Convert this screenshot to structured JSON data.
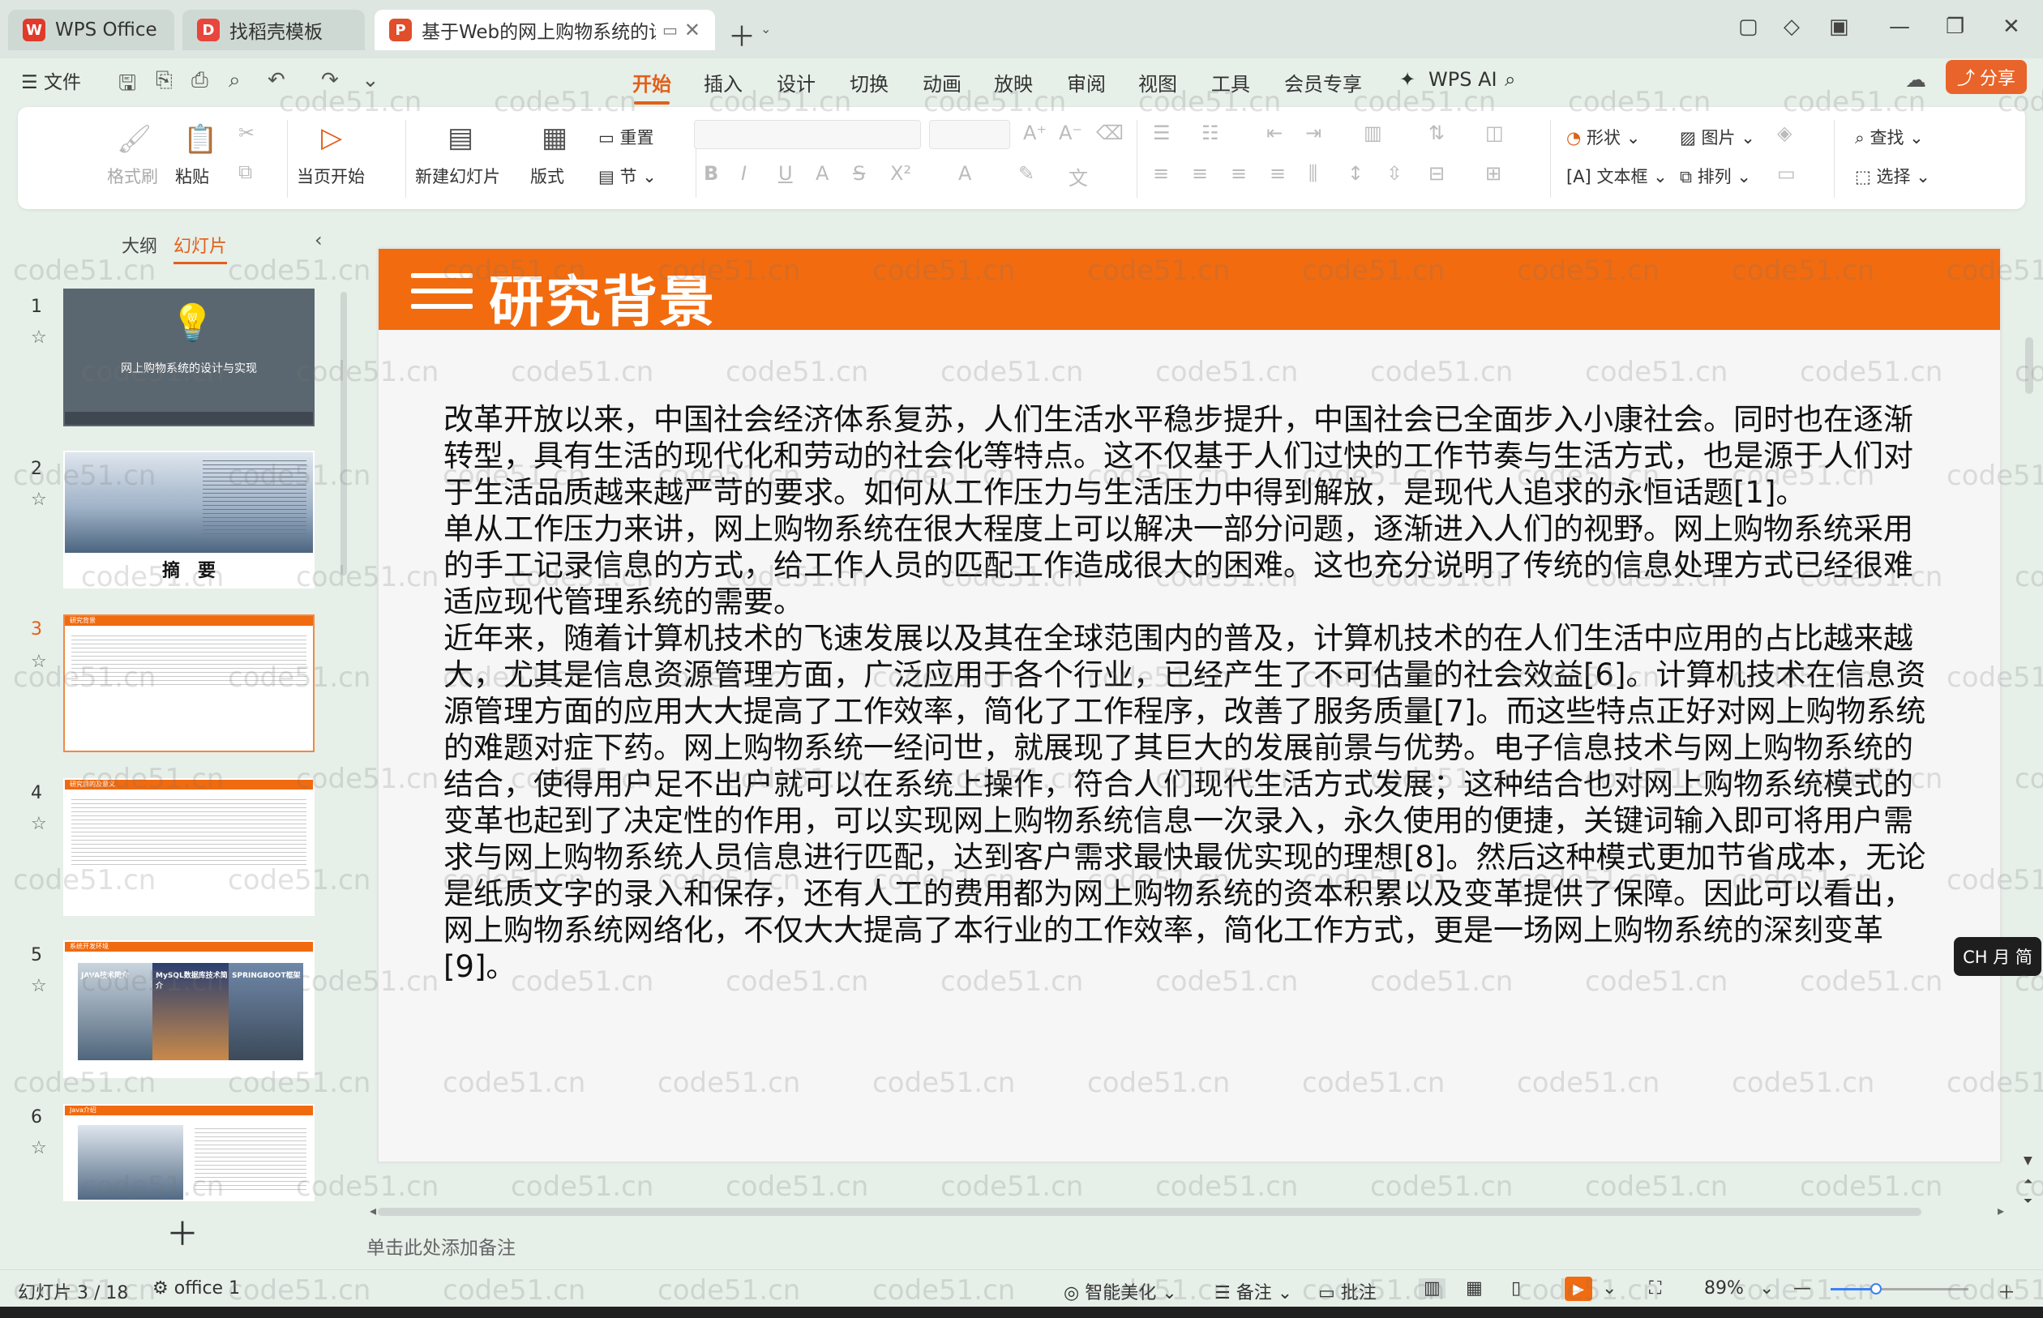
{
  "tabs": [
    {
      "label": "WPS Office"
    },
    {
      "label": "找稻壳模板"
    },
    {
      "label": "基于Web的网上购物系统的设"
    }
  ],
  "menu": {
    "file": "文件",
    "items": [
      "开始",
      "插入",
      "设计",
      "切换",
      "动画",
      "放映",
      "审阅",
      "视图",
      "工具",
      "会员专享",
      "WPS AI"
    ],
    "share": "分享"
  },
  "ribbon": {
    "format_painter": "格式刷",
    "paste": "粘贴",
    "from_current": "当页开始",
    "new_slide": "新建幻灯片",
    "layout": "版式",
    "reset": "重置",
    "section": "节",
    "shape": "形状",
    "picture": "图片",
    "find": "查找",
    "textbox": "文本框",
    "arrange": "排列",
    "select": "选择"
  },
  "panel": {
    "tab_outline": "大纲",
    "tab_slides": "幻灯片",
    "slides": [
      {
        "num": "1",
        "caption": "网上购物系统的设计与实现"
      },
      {
        "num": "2",
        "caption": "摘　要"
      },
      {
        "num": "3",
        "caption": "研究背景"
      },
      {
        "num": "4",
        "caption": "研究目的及意义"
      },
      {
        "num": "5",
        "caption": "系统开发环境",
        "tiles": [
          "JAVA技术简介",
          "MySQL数据库技术简介",
          "SPRINGBOOT框架"
        ]
      },
      {
        "num": "6",
        "caption": "Java介绍"
      }
    ]
  },
  "slide": {
    "title": "研究背景",
    "paragraphs": [
      "改革开放以来，中国社会经济体系复苏，人们生活水平稳步提升，中国社会已全面步入小康社会。同时也在逐渐转型，具有生活的现代化和劳动的社会化等特点。这不仅基于人们过快的工作节奏与生活方式，也是源于人们对于生活品质越来越严苛的要求。如何从工作压力与生活压力中得到解放，是现代人追求的永恒话题[1]。",
      "单从工作压力来讲，网上购物系统在很大程度上可以解决一部分问题，逐渐进入人们的视野。网上购物系统采用的手工记录信息的方式，给工作人员的匹配工作造成很大的困难。这也充分说明了传统的信息处理方式已经很难适应现代管理系统的需要。",
      "近年来，随着计算机技术的飞速发展以及其在全球范围内的普及，计算机技术的在人们生活中应用的占比越来越大，尤其是信息资源管理方面，广泛应用于各个行业，已经产生了不可估量的社会效益[6]。计算机技术在信息资源管理方面的应用大大提高了工作效率，简化了工作程序，改善了服务质量[7]。而这些特点正好对网上购物系统的难题对症下药。网上购物系统一经问世，就展现了其巨大的发展前景与优势。电子信息技术与网上购物系统的结合，使得用户足不出户就可以在系统上操作，符合人们现代生活方式发展；这种结合也对网上购物系统模式的变革也起到了决定性的作用，可以实现网上购物系统信息一次录入，永久使用的便捷，关键词输入即可将用户需求与网上购物系统人员信息进行匹配，达到客户需求最快最优实现的理想[8]。然后这种模式更加节省成本，无论是纸质文字的录入和保存，还有人工的费用都为网上购物系统的资本积累以及变革提供了保障。因此可以看出，网上购物系统网络化，不仅大大提高了本行业的工作效率，简化工作方式，更是一场网上购物系统的深刻变革[9]。"
    ]
  },
  "notes_placeholder": "单击此处添加备注",
  "ime": "CH ⽉ 简",
  "watermark": "code51.cn",
  "status": {
    "slide_info": "幻灯片 3 / 18",
    "theme": "office 1",
    "beautify": "智能美化",
    "notes": "备注",
    "comments": "批注",
    "zoom": "89%",
    "zoom_fraction": 0.33
  },
  "colors": {
    "accent": "#f26b0f",
    "active_menu": "#e0601a"
  }
}
